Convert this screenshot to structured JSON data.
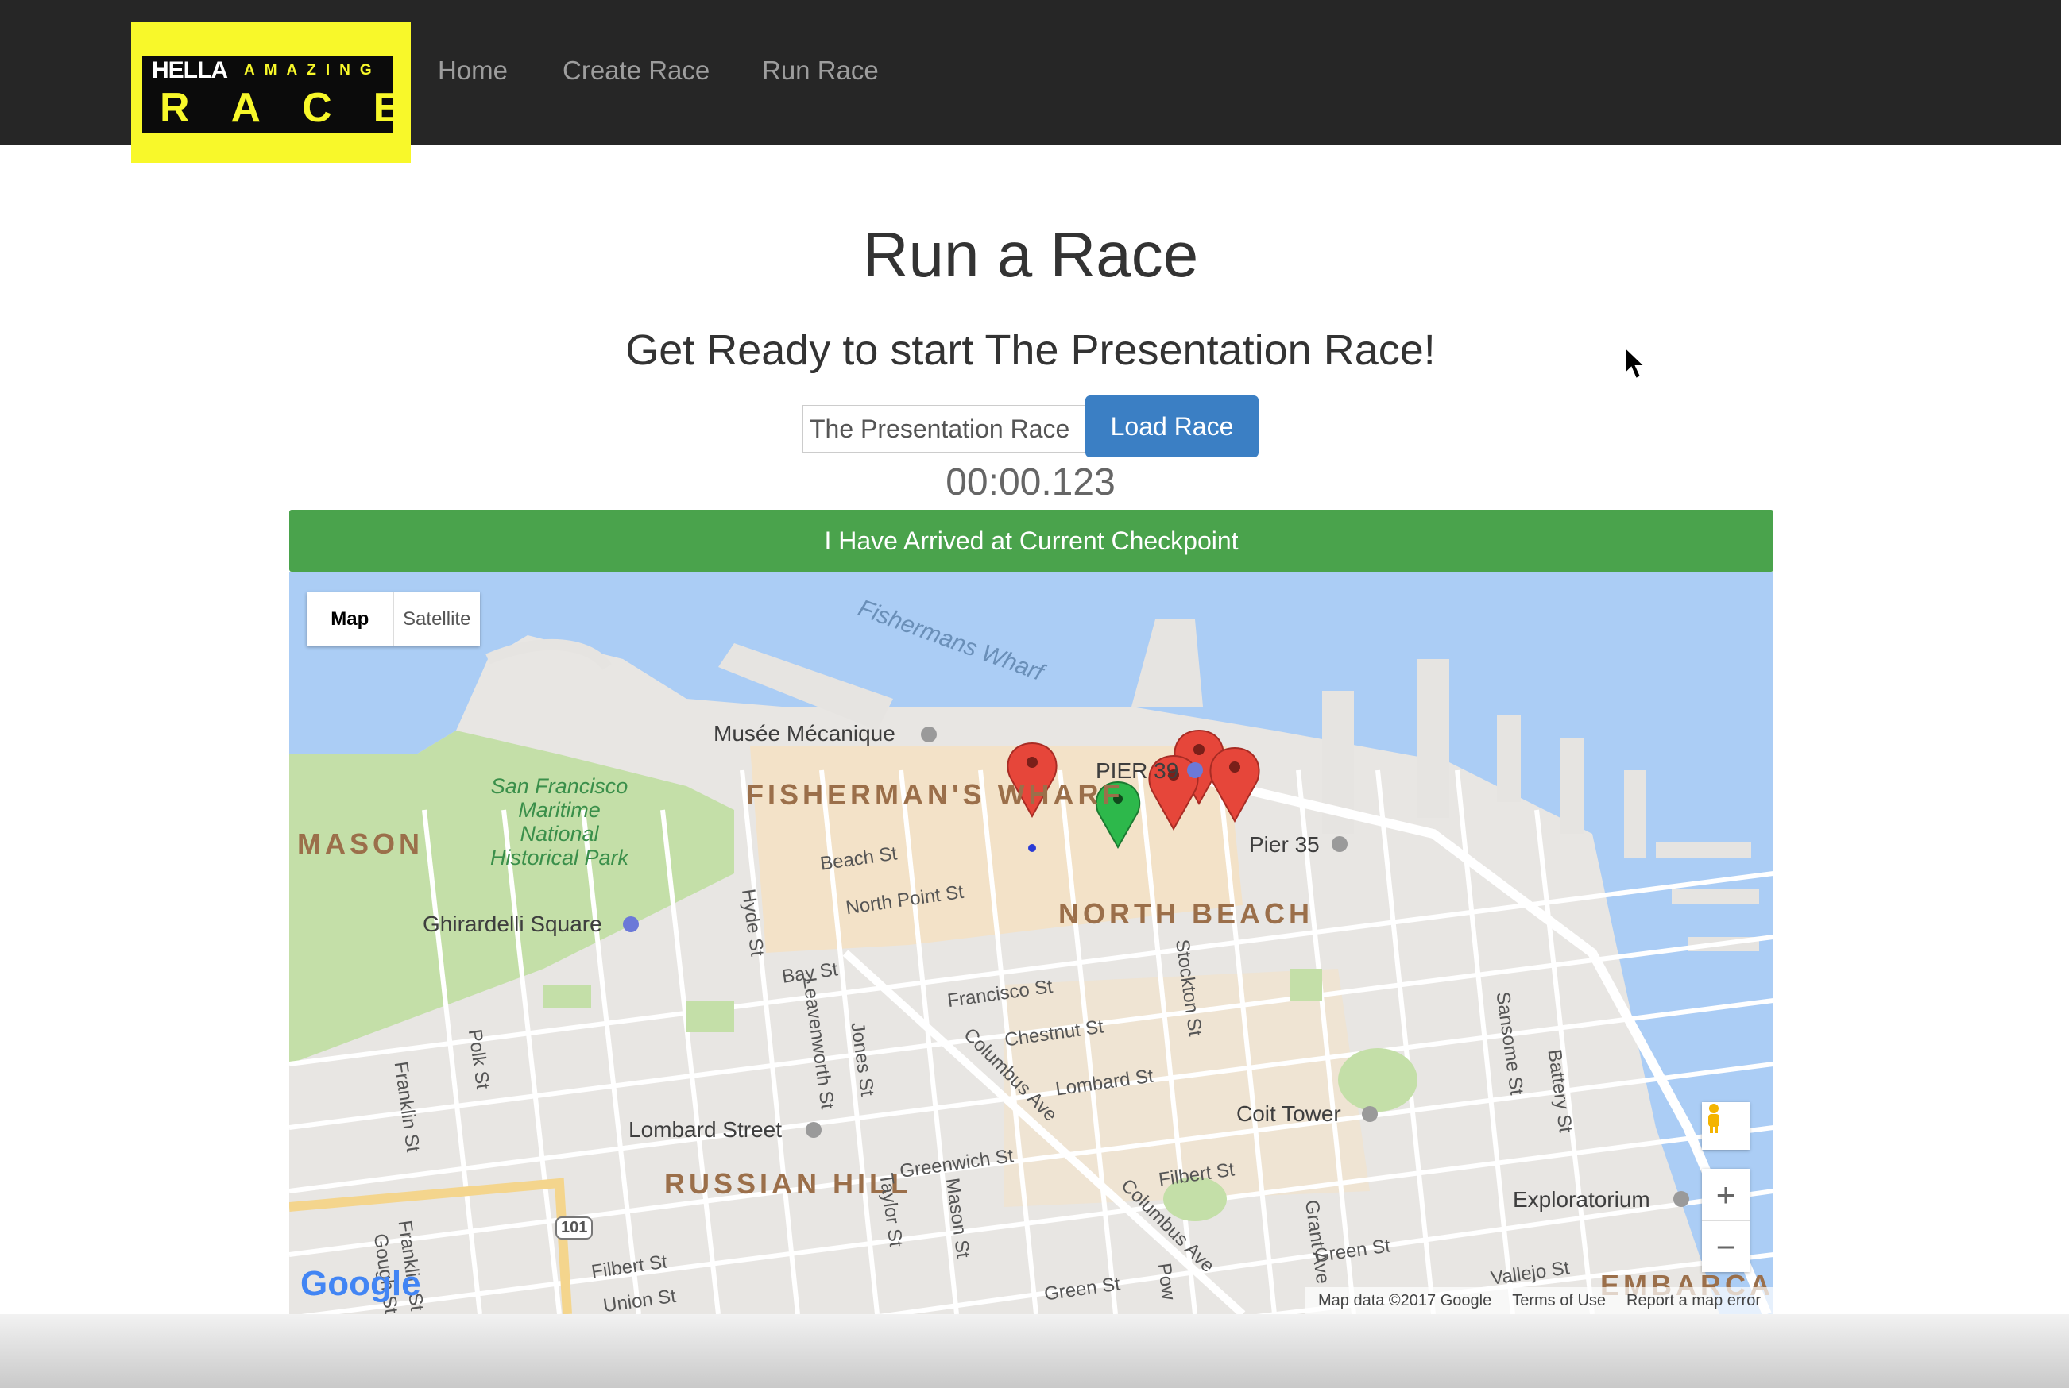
{
  "brand": {
    "line1": "HELLA",
    "line2": "AMAZING",
    "line3": "RACE",
    "colors": {
      "yellow": "#f8f82a",
      "black": "#0b0b0b"
    }
  },
  "nav": {
    "items": [
      {
        "label": "Home"
      },
      {
        "label": "Create Race"
      },
      {
        "label": "Run Race"
      }
    ]
  },
  "main": {
    "title": "Run a Race",
    "subtitle": "Get Ready to start The Presentation Race!",
    "race_input_value": "The Presentation Race",
    "load_button": "Load Race",
    "timer": "00:00.123",
    "arrive_button": "I Have Arrived at Current Checkpoint"
  },
  "map": {
    "type_map": "Map",
    "type_satellite": "Satellite",
    "districts": [
      "FISHERMAN'S WHARF",
      "NORTH BEACH",
      "RUSSIAN HILL",
      "MASON",
      "EMBARCAD"
    ],
    "pois": [
      "Musée Mécanique",
      "PIER 39",
      "Pier 35",
      "Ghirardelli Square",
      "Lombard Street",
      "Coit Tower",
      "Exploratorium"
    ],
    "park": "San Francisco Maritime National Historical Park",
    "water": "Fishermans Wharf",
    "streets": [
      "Beach St",
      "North Point St",
      "Bay St",
      "Francisco St",
      "Chestnut St",
      "Lombard St",
      "Greenwich St",
      "Filbert St",
      "Green St",
      "Vallejo St",
      "Hyde St",
      "Leavenworth St",
      "Jones St",
      "Taylor St",
      "Mason St",
      "Stockton St",
      "Columbus Ave",
      "Columbus Ave",
      "Polk St",
      "Franklin St",
      "Franklin St",
      "Gough St",
      "Grant Ave",
      "Sansome St",
      "Battery St",
      "Union St",
      "101",
      "Pow"
    ],
    "google": "Google",
    "footer": [
      "Map data ©2017 Google",
      "Terms of Use",
      "Report a map error"
    ],
    "zoom_in": "+",
    "zoom_out": "−",
    "colors": {
      "water": "#abcdf5",
      "park": "#c4dfa8",
      "land": "#e8e6e3",
      "district": "#f3e2c8",
      "marker_red": "#e6463a",
      "marker_green": "#2db84b",
      "accent_blue": "#3b7fc4",
      "accent_green": "#4aa34c"
    }
  }
}
